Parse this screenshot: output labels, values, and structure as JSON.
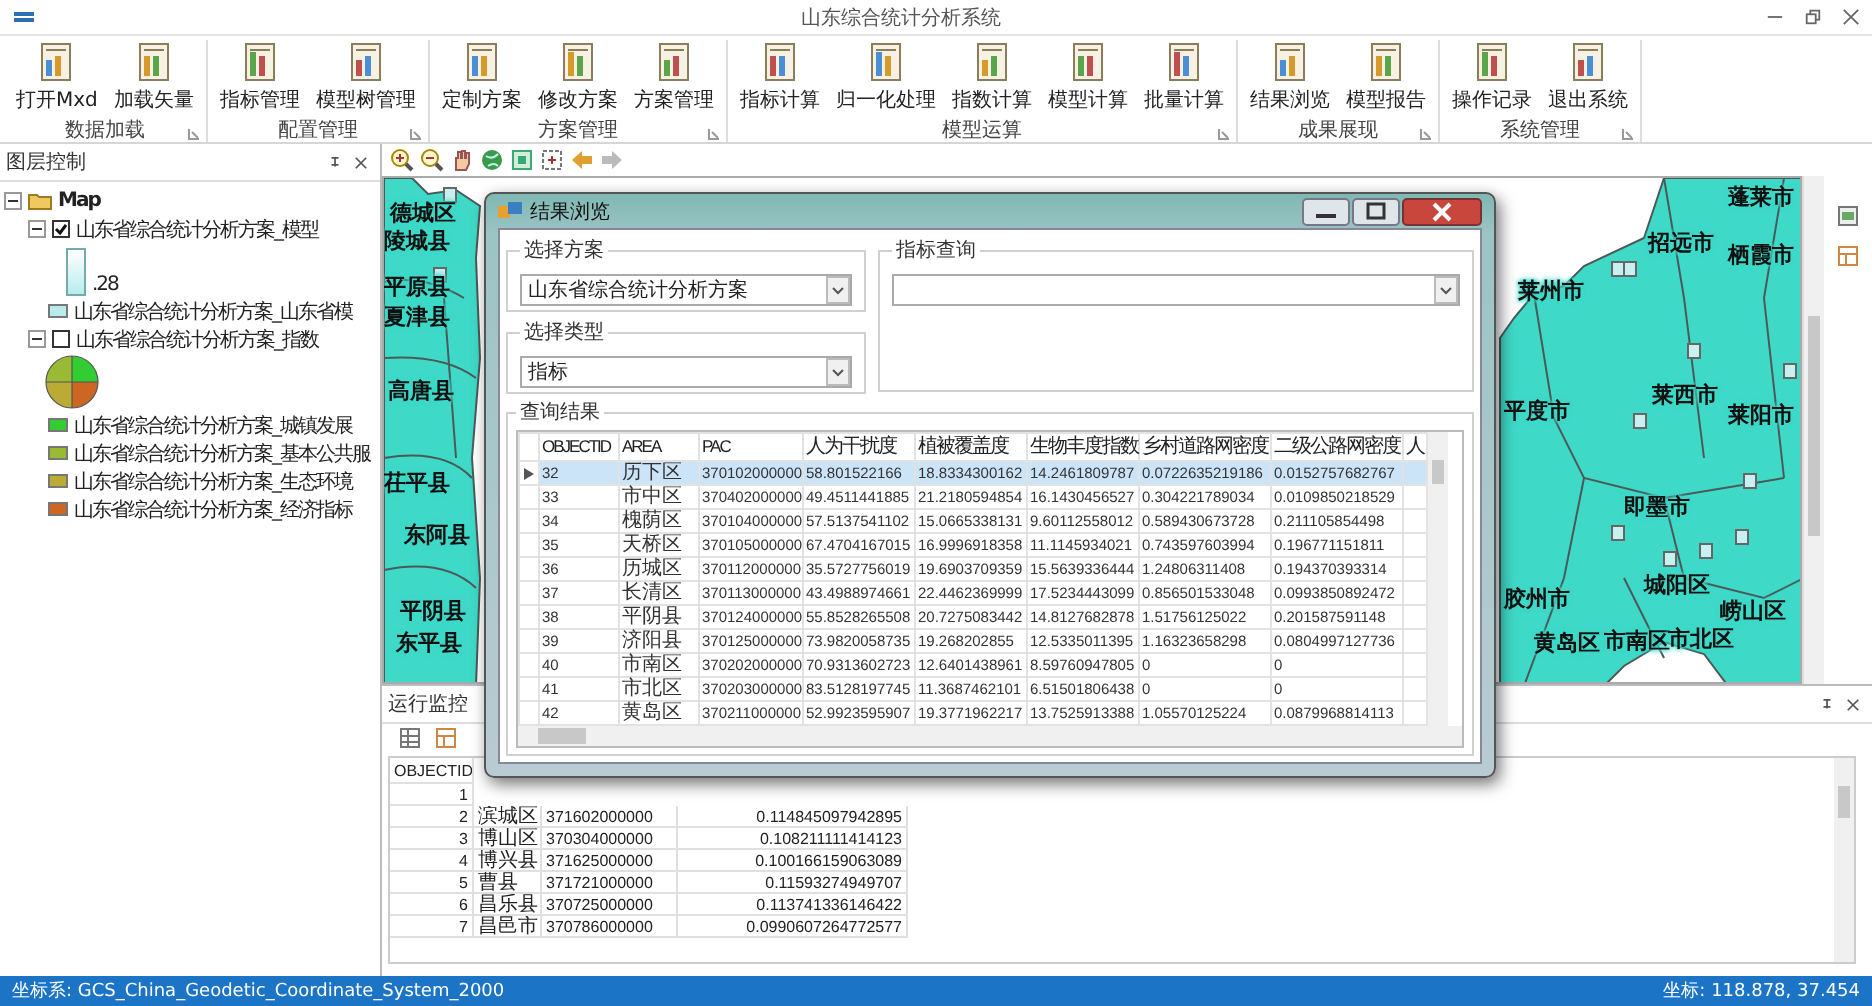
{
  "window": {
    "title": "山东综合统计分析系统"
  },
  "ribbon": [
    {
      "label": "数据加载",
      "buttons": [
        "打开Mxd",
        "加载矢量"
      ]
    },
    {
      "label": "配置管理",
      "buttons": [
        "指标管理",
        "模型树管理"
      ]
    },
    {
      "label": "方案管理",
      "buttons": [
        "定制方案",
        "修改方案",
        "方案管理"
      ]
    },
    {
      "label": "模型运算",
      "buttons": [
        "指标计算",
        "归一化处理",
        "指数计算",
        "模型计算",
        "批量计算"
      ]
    },
    {
      "label": "成果展现",
      "buttons": [
        "结果浏览",
        "模型报告"
      ]
    },
    {
      "label": "系统管理",
      "buttons": [
        "操作记录",
        "退出系统"
      ]
    }
  ],
  "layer_panel": {
    "title": "图层控制",
    "root": {
      "label": "Map",
      "expanded": true
    },
    "layers": [
      {
        "label": "山东省综合统计分析方案_模型",
        "checked": true,
        "expanded": true,
        "legend": {
          "kind": "ramp",
          "ramp_label": ".28",
          "items": [
            {
              "label": "山东省综合统计分析方案_山东省模",
              "color": "#b8ecec"
            }
          ]
        }
      },
      {
        "label": "山东省综合统计分析方案_指数",
        "checked": false,
        "expanded": true,
        "legend": {
          "kind": "pie",
          "items": [
            {
              "label": "山东省综合统计分析方案_城镇发展",
              "color": "#33cc33"
            },
            {
              "label": "山东省综合统计分析方案_基本公共服",
              "color": "#99bb33"
            },
            {
              "label": "山东省综合统计分析方案_生态环境",
              "color": "#bbaa33"
            },
            {
              "label": "山东省综合统计分析方案_经济指标",
              "color": "#cc6622"
            }
          ]
        }
      }
    ]
  },
  "map": {
    "labels": [
      "德城区",
      "陵城县",
      "平原县",
      "夏津县",
      "高唐县",
      "茌平县",
      "东阿县",
      "平阴县",
      "东平县",
      "蓬莱市",
      "招远市",
      "栖霞市",
      "莱州市",
      "平度市",
      "莱西市",
      "莱阳市",
      "即墨市",
      "胶州市",
      "城阳区",
      "崂山区",
      "黄岛区",
      "市南区",
      "市北区"
    ]
  },
  "dialog": {
    "title": "结果浏览",
    "scheme": {
      "label": "选择方案",
      "value": "山东省综合统计分析方案"
    },
    "type": {
      "label": "选择类型",
      "value": "指标"
    },
    "query": {
      "label": "指标查询"
    },
    "results": {
      "label": "查询结果",
      "columns": [
        "OBJECTID",
        "AREA",
        "PAC",
        "人为干扰度",
        "植被覆盖度",
        "生物丰度指数",
        "乡村道路网密度",
        "二级公路网密度",
        "人"
      ],
      "rows": [
        {
          "selected": true,
          "cells": [
            "32",
            "历下区",
            "370102000000",
            "58.801522166",
            "18.8334300162",
            "14.2461809787",
            "0.0722635219186",
            "0.0152757682767"
          ]
        },
        {
          "selected": false,
          "cells": [
            "33",
            "市中区",
            "370402000000",
            "49.4511441885",
            "21.2180594854",
            "16.1430456527",
            "0.304221789034",
            "0.0109850218529"
          ]
        },
        {
          "selected": false,
          "cells": [
            "34",
            "槐荫区",
            "370104000000",
            "57.5137541102",
            "15.0665338131",
            "9.60112558012",
            "0.589430673728",
            "0.211105854498"
          ]
        },
        {
          "selected": false,
          "cells": [
            "35",
            "天桥区",
            "370105000000",
            "67.4704167015",
            "16.9996918358",
            "11.1145934021",
            "0.743597603994",
            "0.196771151811"
          ]
        },
        {
          "selected": false,
          "cells": [
            "36",
            "历城区",
            "370112000000",
            "35.5727756019",
            "19.6903709359",
            "15.5639336444",
            "1.24806311408",
            "0.194370393314"
          ]
        },
        {
          "selected": false,
          "cells": [
            "37",
            "长清区",
            "370113000000",
            "43.4988974661",
            "22.4462369999",
            "17.5234443099",
            "0.856501533048",
            "0.0993850892472"
          ]
        },
        {
          "selected": false,
          "cells": [
            "38",
            "平阴县",
            "370124000000",
            "55.8528265508",
            "20.7275083442",
            "14.8127682878",
            "1.51756125022",
            "0.201587591148"
          ]
        },
        {
          "selected": false,
          "cells": [
            "39",
            "济阳县",
            "370125000000",
            "73.9820058735",
            "19.268202855",
            "12.5335011395",
            "1.16323658298",
            "0.0804997127736"
          ]
        },
        {
          "selected": false,
          "cells": [
            "40",
            "市南区",
            "370202000000",
            "70.9313602723",
            "12.6401438961",
            "8.59760947805",
            "0",
            "0"
          ]
        },
        {
          "selected": false,
          "cells": [
            "41",
            "市北区",
            "370203000000",
            "83.5128197745",
            "11.3687462101",
            "6.51501806438",
            "0",
            "0"
          ]
        },
        {
          "selected": false,
          "cells": [
            "42",
            "黄岛区",
            "370211000000",
            "52.9923595907",
            "19.3771962217",
            "13.7525913388",
            "1.05570125224",
            "0.0879968814113"
          ]
        }
      ]
    }
  },
  "monitor": {
    "title": "运行监控",
    "columns": [
      "OBJECTID"
    ],
    "rows": [
      [
        "1"
      ],
      [
        "2",
        "滨城区",
        "371602000000",
        "0.114845097942895"
      ],
      [
        "3",
        "博山区",
        "370304000000",
        "0.108211111414123"
      ],
      [
        "4",
        "博兴县",
        "371625000000",
        "0.100166159063089"
      ],
      [
        "5",
        "曹县",
        "371721000000",
        "0.11593274949707"
      ],
      [
        "6",
        "昌乐县",
        "370725000000",
        "0.113741336146422"
      ],
      [
        "7",
        "昌邑市",
        "370786000000",
        "0.0990607264772577"
      ]
    ]
  },
  "status_bar": {
    "crs": "坐标系: GCS_China_Geodetic_Coordinate_System_2000",
    "coords": "坐标: 118.878, 37.454"
  }
}
